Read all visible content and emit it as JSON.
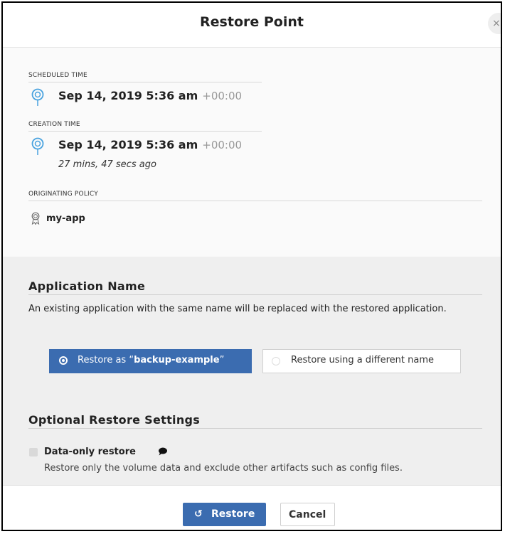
{
  "dialog": {
    "title": "Restore Point",
    "close_symbol": "×"
  },
  "info": {
    "scheduled": {
      "label": "SCHEDULED TIME",
      "time": "Sep 14, 2019 5:36 am",
      "timezone": "+00:00"
    },
    "creation": {
      "label": "CREATION TIME",
      "time": "Sep 14, 2019 5:36 am",
      "timezone": "+00:00",
      "relative": "27 mins, 47 secs ago"
    },
    "policy": {
      "label": "ORIGINATING POLICY",
      "name": "my-app"
    }
  },
  "app_name": {
    "title": "Application Name",
    "description": "An existing application with the same name will be replaced with the restored application.",
    "options": [
      {
        "prefix": "Restore as “",
        "name": "backup-example",
        "suffix": "”",
        "selected": true
      },
      {
        "label": "Restore using a different name",
        "selected": false
      }
    ]
  },
  "optional": {
    "title": "Optional Restore Settings",
    "data_only": {
      "label": "Data-only restore",
      "description": "Restore only the volume data and exclude other artifacts such as config files.",
      "checked": false
    }
  },
  "footer": {
    "restore_icon": "↺",
    "restore_label": "Restore",
    "cancel_label": "Cancel"
  },
  "colors": {
    "accent": "#3b6cb0",
    "pin": "#4aa3df",
    "panel_bg": "#efefef"
  },
  "icons": {
    "location": "location-pin-icon",
    "policy": "ribbon-badge-icon",
    "comment": "speech-bubble-icon",
    "restore": "restore-arrow-icon"
  }
}
